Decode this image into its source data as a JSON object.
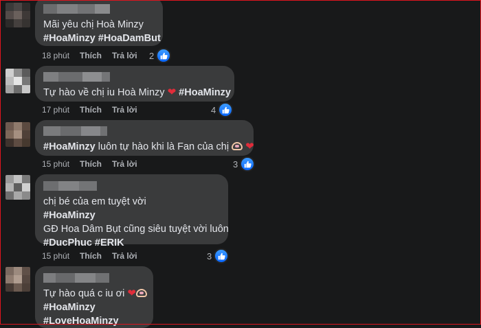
{
  "colors": {
    "background": "#18191a",
    "bubble": "#3a3b3c",
    "heart": "#e02c3a",
    "like": "#0866ff"
  },
  "comments": [
    {
      "lines": [
        {
          "text": "Mãi yêu chị Hoà Minzy"
        },
        {
          "text": "#HoaMinzy #HoaDamBut"
        }
      ],
      "time": "18 phút",
      "like": "Thích",
      "reply": "Trả lời",
      "reactions": "2"
    },
    {
      "lines": [
        {
          "text": "Tự hào về chị iu Hoà Minzy",
          "tag": "#HoaMinzy"
        }
      ],
      "time": "17 phút",
      "like": "Thích",
      "reply": "Trả lời",
      "reactions": "4"
    },
    {
      "lines": [
        {
          "tag": "#HoaMinzy",
          "text": "luôn tự hào khi là Fan của chị"
        }
      ],
      "time": "15 phút",
      "like": "Thích",
      "reply": "Trả lời",
      "reactions": "3"
    },
    {
      "lines": [
        {
          "text": "chị bé của em tuyệt vời"
        },
        {
          "text": "#HoaMinzy"
        },
        {
          "text": "GĐ Hoa Dâm Bụt cũng siêu tuyệt vời luôn"
        },
        {
          "text": "#DucPhuc #ERIK"
        }
      ],
      "time": "15 phút",
      "like": "Thích",
      "reply": "Trả lời",
      "reactions": "3"
    },
    {
      "lines": [
        {
          "text": "Tự hào quá c iu ơi"
        },
        {
          "text": "#HoaMinzy"
        },
        {
          "text": "#LoveHoaMinzy"
        }
      ]
    }
  ]
}
